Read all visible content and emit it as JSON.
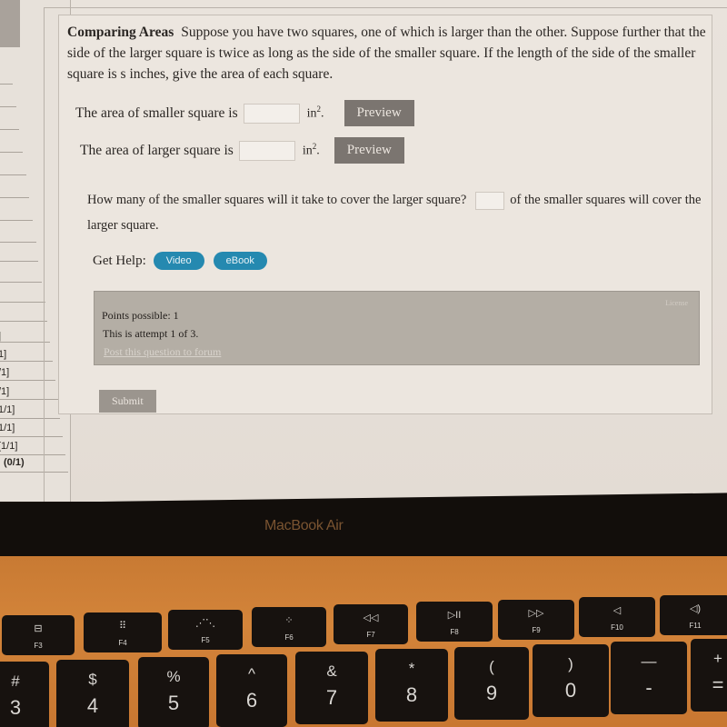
{
  "sidebar": {
    "scores": [
      "]",
      "1]",
      "/1]",
      "/1]",
      "1/1]",
      "1/1]",
      "[1/1]",
      "[1/1]",
      "(0/1)"
    ]
  },
  "question": {
    "title": "Comparing Areas",
    "body": "Suppose you have two squares, one of which is larger than the other. Suppose further that the side of the larger square is twice as long as the side of the smaller square. If the length of the side of the smaller square is s inches, give the area of each square.",
    "rows": [
      {
        "label": "The area of smaller square is",
        "value": "",
        "unit": "in",
        "unit_exp": "2",
        "button": "Preview"
      },
      {
        "label": "The area of larger square is",
        "value": "",
        "unit": "in",
        "unit_exp": "2",
        "button": "Preview"
      }
    ],
    "count_question": "How many of the smaller squares will it take to cover the larger square?",
    "count_value": "",
    "count_suffix": "of the smaller squares will cover the larger square.",
    "help_label": "Get Help:",
    "help_buttons": [
      "Video",
      "eBook"
    ]
  },
  "info": {
    "points": "Points possible: 1",
    "attempt": "This is attempt 1 of 3.",
    "forum_link": "Post this question to forum",
    "license_link": "License"
  },
  "submit_label": "Submit",
  "device": {
    "brand": "MacBook Air",
    "function_keys": [
      {
        "glyph": "⊟",
        "label": "F3",
        "icon": "mission-control-icon"
      },
      {
        "glyph": "⠿",
        "label": "F4",
        "icon": "launchpad-icon"
      },
      {
        "glyph": "⋰⋱",
        "label": "F5",
        "icon": "keyboard-brightness-down-icon"
      },
      {
        "glyph": "⁘",
        "label": "F6",
        "icon": "keyboard-brightness-up-icon"
      },
      {
        "glyph": "◁◁",
        "label": "F7",
        "icon": "rewind-icon"
      },
      {
        "glyph": "▷II",
        "label": "F8",
        "icon": "play-pause-icon"
      },
      {
        "glyph": "▷▷",
        "label": "F9",
        "icon": "fast-forward-icon"
      },
      {
        "glyph": "◁",
        "label": "F10",
        "icon": "mute-icon"
      },
      {
        "glyph": "◁)",
        "label": "F11",
        "icon": "volume-down-icon"
      }
    ],
    "number_keys": [
      {
        "sym": "#",
        "num": "3"
      },
      {
        "sym": "$",
        "num": "4"
      },
      {
        "sym": "%",
        "num": "5"
      },
      {
        "sym": "^",
        "num": "6"
      },
      {
        "sym": "&",
        "num": "7"
      },
      {
        "sym": "*",
        "num": "8"
      },
      {
        "sym": "(",
        "num": "9"
      },
      {
        "sym": ")",
        "num": "0"
      },
      {
        "sym": "—",
        "num": "-"
      },
      {
        "sym": "+",
        "num": "="
      }
    ]
  }
}
